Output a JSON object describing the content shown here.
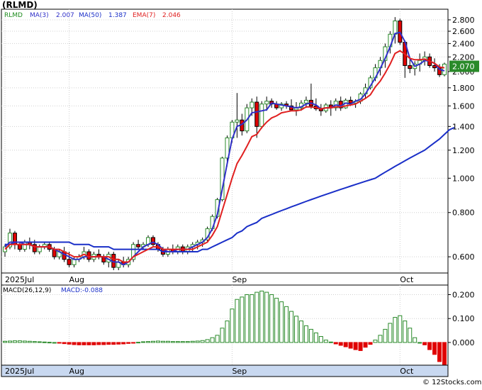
{
  "chart_data": [
    {
      "type": "candlestick",
      "title": "(RLMD)",
      "indicators": [
        {
          "name": "MA(3)",
          "value": "2.007",
          "color": "#3030c8"
        },
        {
          "name": "MA(50)",
          "value": "1.387",
          "color": "#1a2fc8"
        },
        {
          "name": "EMA(7)",
          "value": "2.046",
          "color": "#e02020"
        }
      ],
      "last_price": "2.070",
      "y_scale": "log",
      "ylim": [
        0.54,
        3.0
      ],
      "y_ticks": [
        "2.800",
        "2.600",
        "2.400",
        "2.200",
        "2.000",
        "1.800",
        "1.600",
        "1.400",
        "1.200",
        "1.000",
        "0.800",
        "0.600"
      ],
      "x_labels": [
        {
          "label": "2025Jul",
          "index": 0
        },
        {
          "label": "Aug",
          "index": 13
        },
        {
          "label": "Sep",
          "index": 46
        },
        {
          "label": "Oct",
          "index": 80
        }
      ],
      "grid": true,
      "colors": {
        "up": "#2a8a2a",
        "down": "#e00000",
        "last_price_box": "#2a8a2a"
      },
      "candles": [
        [
          0.62,
          0.65,
          0.6,
          0.64
        ],
        [
          0.64,
          0.72,
          0.63,
          0.7
        ],
        [
          0.7,
          0.71,
          0.63,
          0.65
        ],
        [
          0.65,
          0.66,
          0.62,
          0.63
        ],
        [
          0.63,
          0.67,
          0.62,
          0.66
        ],
        [
          0.66,
          0.68,
          0.63,
          0.65
        ],
        [
          0.65,
          0.67,
          0.61,
          0.62
        ],
        [
          0.62,
          0.65,
          0.61,
          0.64
        ],
        [
          0.64,
          0.66,
          0.63,
          0.65
        ],
        [
          0.65,
          0.66,
          0.62,
          0.63
        ],
        [
          0.63,
          0.64,
          0.59,
          0.6
        ],
        [
          0.6,
          0.63,
          0.59,
          0.62
        ],
        [
          0.62,
          0.64,
          0.58,
          0.59
        ],
        [
          0.59,
          0.62,
          0.56,
          0.57
        ],
        [
          0.57,
          0.6,
          0.56,
          0.59
        ],
        [
          0.59,
          0.61,
          0.58,
          0.6
        ],
        [
          0.6,
          0.64,
          0.59,
          0.62
        ],
        [
          0.62,
          0.63,
          0.58,
          0.59
        ],
        [
          0.59,
          0.62,
          0.58,
          0.61
        ],
        [
          0.61,
          0.63,
          0.59,
          0.6
        ],
        [
          0.6,
          0.61,
          0.57,
          0.58
        ],
        [
          0.58,
          0.62,
          0.56,
          0.61
        ],
        [
          0.61,
          0.62,
          0.55,
          0.56
        ],
        [
          0.56,
          0.59,
          0.55,
          0.58
        ],
        [
          0.58,
          0.6,
          0.56,
          0.57
        ],
        [
          0.57,
          0.6,
          0.56,
          0.59
        ],
        [
          0.59,
          0.66,
          0.58,
          0.65
        ],
        [
          0.65,
          0.67,
          0.63,
          0.64
        ],
        [
          0.64,
          0.66,
          0.63,
          0.65
        ],
        [
          0.65,
          0.69,
          0.64,
          0.68
        ],
        [
          0.68,
          0.69,
          0.64,
          0.65
        ],
        [
          0.65,
          0.66,
          0.62,
          0.63
        ],
        [
          0.63,
          0.64,
          0.6,
          0.61
        ],
        [
          0.61,
          0.64,
          0.6,
          0.63
        ],
        [
          0.63,
          0.65,
          0.61,
          0.62
        ],
        [
          0.62,
          0.65,
          0.61,
          0.64
        ],
        [
          0.64,
          0.65,
          0.61,
          0.62
        ],
        [
          0.62,
          0.65,
          0.61,
          0.64
        ],
        [
          0.64,
          0.66,
          0.62,
          0.65
        ],
        [
          0.65,
          0.67,
          0.63,
          0.66
        ],
        [
          0.66,
          0.68,
          0.64,
          0.67
        ],
        [
          0.67,
          0.73,
          0.66,
          0.72
        ],
        [
          0.72,
          0.79,
          0.71,
          0.78
        ],
        [
          0.78,
          0.88,
          0.77,
          0.87
        ],
        [
          0.87,
          1.15,
          0.86,
          1.14
        ],
        [
          1.14,
          1.32,
          1.08,
          1.3
        ],
        [
          1.3,
          1.46,
          1.26,
          1.44
        ],
        [
          1.44,
          1.74,
          1.3,
          1.46
        ],
        [
          1.46,
          1.52,
          1.32,
          1.36
        ],
        [
          1.36,
          1.62,
          1.34,
          1.58
        ],
        [
          1.58,
          1.68,
          1.5,
          1.64
        ],
        [
          1.64,
          1.7,
          1.3,
          1.4
        ],
        [
          1.4,
          1.65,
          1.38,
          1.62
        ],
        [
          1.62,
          1.7,
          1.55,
          1.65
        ],
        [
          1.65,
          1.68,
          1.58,
          1.62
        ],
        [
          1.62,
          1.65,
          1.56,
          1.58
        ],
        [
          1.58,
          1.64,
          1.55,
          1.62
        ],
        [
          1.62,
          1.65,
          1.57,
          1.6
        ],
        [
          1.6,
          1.67,
          1.55,
          1.56
        ],
        [
          1.56,
          1.64,
          1.5,
          1.58
        ],
        [
          1.58,
          1.66,
          1.55,
          1.63
        ],
        [
          1.63,
          1.7,
          1.58,
          1.66
        ],
        [
          1.66,
          1.85,
          1.57,
          1.6
        ],
        [
          1.6,
          1.68,
          1.55,
          1.57
        ],
        [
          1.57,
          1.62,
          1.5,
          1.55
        ],
        [
          1.55,
          1.63,
          1.53,
          1.61
        ],
        [
          1.61,
          1.66,
          1.5,
          1.58
        ],
        [
          1.58,
          1.68,
          1.55,
          1.65
        ],
        [
          1.65,
          1.7,
          1.55,
          1.58
        ],
        [
          1.58,
          1.68,
          1.57,
          1.66
        ],
        [
          1.66,
          1.7,
          1.6,
          1.63
        ],
        [
          1.63,
          1.67,
          1.58,
          1.65
        ],
        [
          1.65,
          1.75,
          1.62,
          1.73
        ],
        [
          1.73,
          1.85,
          1.68,
          1.8
        ],
        [
          1.8,
          1.95,
          1.78,
          1.92
        ],
        [
          1.92,
          2.1,
          1.88,
          2.05
        ],
        [
          2.05,
          2.2,
          1.95,
          2.15
        ],
        [
          2.15,
          2.4,
          2.05,
          2.35
        ],
        [
          2.35,
          2.6,
          2.25,
          2.55
        ],
        [
          2.55,
          2.85,
          2.4,
          2.78
        ],
        [
          2.78,
          2.82,
          2.38,
          2.42
        ],
        [
          2.42,
          2.45,
          1.92,
          2.08
        ],
        [
          2.08,
          2.2,
          1.98,
          2.04
        ],
        [
          2.04,
          2.14,
          1.95,
          2.1
        ],
        [
          2.1,
          2.25,
          2.0,
          2.15
        ],
        [
          2.15,
          2.28,
          2.08,
          2.2
        ],
        [
          2.2,
          2.25,
          2.05,
          2.08
        ],
        [
          2.08,
          2.18,
          2.0,
          2.05
        ],
        [
          2.05,
          2.1,
          1.93,
          1.96
        ],
        [
          1.96,
          2.12,
          1.94,
          2.1
        ]
      ],
      "ma_short": [
        0.64,
        0.66,
        0.66,
        0.66,
        0.65,
        0.65,
        0.64,
        0.64,
        0.64,
        0.64,
        0.63,
        0.62,
        0.61,
        0.6,
        0.59,
        0.59,
        0.6,
        0.6,
        0.6,
        0.6,
        0.6,
        0.59,
        0.58,
        0.58,
        0.57,
        0.58,
        0.6,
        0.62,
        0.64,
        0.65,
        0.66,
        0.65,
        0.63,
        0.62,
        0.62,
        0.63,
        0.63,
        0.63,
        0.64,
        0.65,
        0.66,
        0.68,
        0.72,
        0.79,
        0.93,
        1.1,
        1.29,
        1.4,
        1.42,
        1.46,
        1.53,
        1.54,
        1.55,
        1.56,
        1.63,
        1.62,
        1.61,
        1.6,
        1.59,
        1.58,
        1.59,
        1.62,
        1.63,
        1.61,
        1.57,
        1.58,
        1.58,
        1.61,
        1.6,
        1.63,
        1.62,
        1.65,
        1.67,
        1.73,
        1.82,
        1.92,
        2.04,
        2.18,
        2.35,
        2.56,
        2.58,
        2.43,
        2.18,
        2.07,
        2.1,
        2.15,
        2.14,
        2.11,
        2.03,
        2.01
      ],
      "ma_long": [
        0.65,
        0.65,
        0.66,
        0.66,
        0.66,
        0.66,
        0.66,
        0.66,
        0.66,
        0.66,
        0.66,
        0.66,
        0.66,
        0.66,
        0.65,
        0.65,
        0.65,
        0.65,
        0.64,
        0.64,
        0.64,
        0.64,
        0.63,
        0.63,
        0.63,
        0.63,
        0.63,
        0.63,
        0.63,
        0.63,
        0.63,
        0.63,
        0.62,
        0.62,
        0.62,
        0.62,
        0.62,
        0.62,
        0.62,
        0.62,
        0.63,
        0.63,
        0.64,
        0.65,
        0.66,
        0.67,
        0.68,
        0.7,
        0.71,
        0.73,
        0.74,
        0.75,
        0.77,
        0.78,
        0.79,
        0.8,
        0.81,
        0.82,
        0.83,
        0.84,
        0.85,
        0.86,
        0.87,
        0.88,
        0.89,
        0.9,
        0.91,
        0.92,
        0.93,
        0.94,
        0.95,
        0.96,
        0.97,
        0.98,
        0.99,
        1.0,
        1.02,
        1.04,
        1.06,
        1.08,
        1.1,
        1.12,
        1.14,
        1.16,
        1.18,
        1.2,
        1.23,
        1.26,
        1.29,
        1.33,
        1.37,
        1.39
      ],
      "ema": [
        0.63,
        0.65,
        0.65,
        0.65,
        0.65,
        0.65,
        0.64,
        0.64,
        0.64,
        0.64,
        0.63,
        0.63,
        0.62,
        0.61,
        0.6,
        0.6,
        0.61,
        0.6,
        0.6,
        0.6,
        0.6,
        0.6,
        0.59,
        0.59,
        0.58,
        0.58,
        0.6,
        0.61,
        0.62,
        0.63,
        0.64,
        0.64,
        0.63,
        0.63,
        0.63,
        0.63,
        0.63,
        0.63,
        0.63,
        0.64,
        0.65,
        0.66,
        0.69,
        0.73,
        0.81,
        0.9,
        1.0,
        1.1,
        1.16,
        1.23,
        1.31,
        1.33,
        1.39,
        1.44,
        1.48,
        1.5,
        1.53,
        1.54,
        1.55,
        1.55,
        1.56,
        1.59,
        1.59,
        1.58,
        1.57,
        1.58,
        1.58,
        1.59,
        1.59,
        1.6,
        1.61,
        1.62,
        1.65,
        1.68,
        1.72,
        1.81,
        1.88,
        1.98,
        2.1,
        2.25,
        2.29,
        2.24,
        2.18,
        2.16,
        2.16,
        2.17,
        2.14,
        2.11,
        2.06,
        2.05
      ]
    },
    {
      "type": "bar",
      "title": "MACD(26,12,9)",
      "value_label": "MACD:-0.088",
      "ylim": [
        -0.095,
        0.24
      ],
      "y_ticks": [
        "0.200",
        "0.100",
        "0.000"
      ],
      "x_labels": [
        {
          "label": "2025Jul",
          "index": 0
        },
        {
          "label": "Aug",
          "index": 13
        },
        {
          "label": "Sep",
          "index": 46
        },
        {
          "label": "Oct",
          "index": 80
        }
      ],
      "colors": {
        "positive": "#2a8a2a",
        "negative": "#e00000"
      },
      "values": [
        0.005,
        0.006,
        0.007,
        0.007,
        0.006,
        0.005,
        0.004,
        0.003,
        0.002,
        0.001,
        0.0,
        -0.003,
        -0.005,
        -0.007,
        -0.009,
        -0.01,
        -0.01,
        -0.01,
        -0.01,
        -0.009,
        -0.009,
        -0.008,
        -0.008,
        -0.007,
        -0.006,
        -0.004,
        -0.002,
        0.001,
        0.003,
        0.004,
        0.005,
        0.006,
        0.005,
        0.005,
        0.004,
        0.004,
        0.004,
        0.004,
        0.005,
        0.006,
        0.008,
        0.012,
        0.02,
        0.03,
        0.06,
        0.09,
        0.14,
        0.18,
        0.19,
        0.2,
        0.2,
        0.21,
        0.215,
        0.21,
        0.2,
        0.185,
        0.17,
        0.15,
        0.13,
        0.11,
        0.09,
        0.07,
        0.055,
        0.04,
        0.025,
        0.01,
        0.002,
        -0.006,
        -0.012,
        -0.018,
        -0.024,
        -0.03,
        -0.034,
        -0.02,
        -0.008,
        0.01,
        0.03,
        0.055,
        0.08,
        0.105,
        0.112,
        0.09,
        0.06,
        0.02,
        0.0,
        -0.01,
        -0.03,
        -0.05,
        -0.08,
        -0.092
      ]
    }
  ],
  "watermark": "© 12Stocks.com"
}
